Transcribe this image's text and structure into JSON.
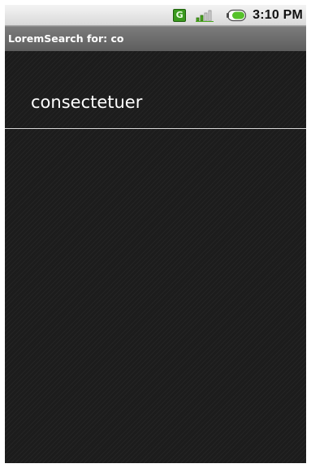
{
  "status_bar": {
    "data_icon_letter": "G",
    "time": "3:10 PM",
    "icons": [
      "data-g-icon",
      "signal-icon",
      "battery-icon"
    ],
    "colors": {
      "data_icon": "#3a9a1e",
      "battery_fill": "#55c12a"
    }
  },
  "title_bar": {
    "title": "LoremSearch for: co"
  },
  "results": [
    {
      "label": "consectetuer"
    }
  ],
  "colors": {
    "background": "#1c1c1c",
    "title_bar": "#6e6e6e",
    "divider": "#d8d8d8",
    "text": "#ffffff"
  }
}
